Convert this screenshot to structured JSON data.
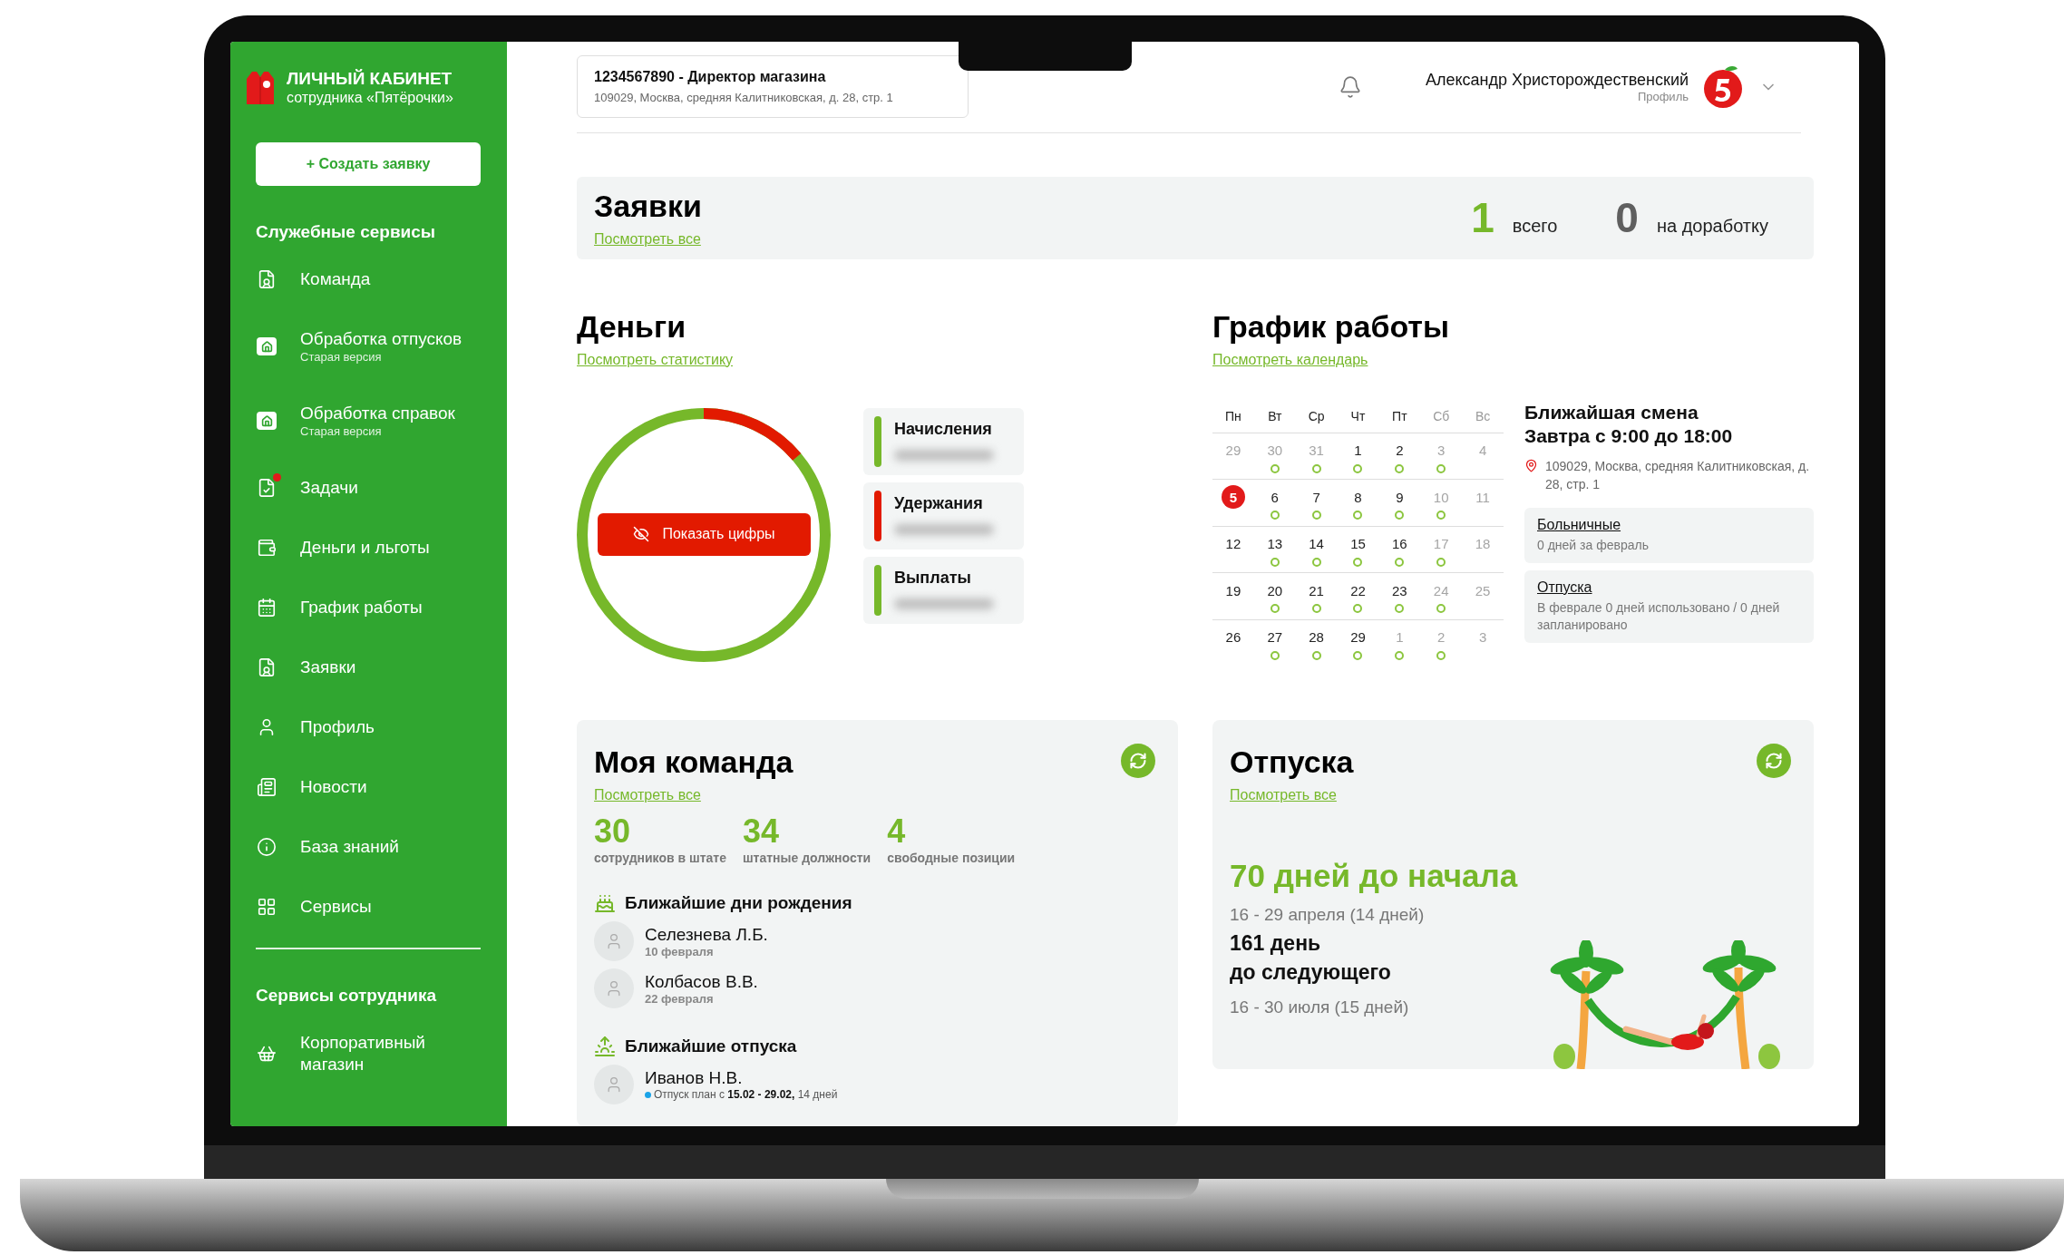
{
  "sidebar": {
    "logo_title": "ЛИЧНЫЙ КАБИНЕТ",
    "logo_subtitle": "сотрудника «Пятёрочки»",
    "create_button": "+ Создать заявку",
    "sections": [
      {
        "title": "Служебные сервисы",
        "items": [
          {
            "label": "Команда",
            "badge": false
          },
          {
            "label": "Обработка отпусков",
            "sublabel": "Старая версия",
            "badge": false
          },
          {
            "label": "Обработка справок",
            "sublabel": "Старая версия",
            "badge": false
          },
          {
            "label": "Задачи",
            "badge": true
          },
          {
            "label": "Деньги и льготы",
            "badge": false
          },
          {
            "label": "График работы",
            "badge": false
          },
          {
            "label": "Заявки",
            "badge": false
          },
          {
            "label": "Профиль",
            "badge": false
          },
          {
            "label": "Новости",
            "badge": false
          },
          {
            "label": "База знаний",
            "badge": false
          },
          {
            "label": "Сервисы",
            "badge": false
          }
        ]
      },
      {
        "title": "Сервисы сотрудника",
        "items": [
          {
            "label": "Корпоративный магазин",
            "badge": false
          }
        ]
      }
    ]
  },
  "header": {
    "store_title": "1234567890 - Директор магазина",
    "store_address": "109029, Москва, средняя Калитниковская, д. 28, стр. 1",
    "user_name": "Александр Христорождественский",
    "user_role": "Профиль"
  },
  "requests": {
    "title": "Заявки",
    "link": "Посмотреть все",
    "stats": [
      {
        "value": "1",
        "label": "всего",
        "color": "#76b82a"
      },
      {
        "value": "0",
        "label": "на доработку",
        "color": "#5f5f5f"
      }
    ]
  },
  "money": {
    "title": "Деньги",
    "link": "Посмотреть статистику",
    "show_button": "Показать цифры",
    "legend": [
      {
        "label": "Начисления",
        "color": "#76b82a"
      },
      {
        "label": "Удержания",
        "color": "#e21a00"
      },
      {
        "label": "Выплаты",
        "color": "#76b82a"
      }
    ]
  },
  "schedule": {
    "title": "График работы",
    "link": "Посмотреть календарь",
    "weekdays": [
      {
        "label": "Пн",
        "weekend": false
      },
      {
        "label": "Вт",
        "weekend": false
      },
      {
        "label": "Ср",
        "weekend": false
      },
      {
        "label": "Чт",
        "weekend": false
      },
      {
        "label": "Пт",
        "weekend": false
      },
      {
        "label": "Сб",
        "weekend": true
      },
      {
        "label": "Вс",
        "weekend": true
      }
    ],
    "weeks": [
      [
        {
          "day": "29",
          "muted": true,
          "shift": false,
          "today": false
        },
        {
          "day": "30",
          "muted": true,
          "shift": true,
          "today": false
        },
        {
          "day": "31",
          "muted": true,
          "shift": true,
          "today": false
        },
        {
          "day": "1",
          "muted": false,
          "shift": true,
          "today": false
        },
        {
          "day": "2",
          "muted": false,
          "shift": true,
          "today": false
        },
        {
          "day": "3",
          "muted": true,
          "shift": true,
          "today": false
        },
        {
          "day": "4",
          "muted": true,
          "shift": false,
          "today": false
        }
      ],
      [
        {
          "day": "5",
          "muted": false,
          "shift": false,
          "today": true
        },
        {
          "day": "6",
          "muted": false,
          "shift": true,
          "today": false
        },
        {
          "day": "7",
          "muted": false,
          "shift": true,
          "today": false
        },
        {
          "day": "8",
          "muted": false,
          "shift": true,
          "today": false
        },
        {
          "day": "9",
          "muted": false,
          "shift": true,
          "today": false
        },
        {
          "day": "10",
          "muted": true,
          "shift": true,
          "today": false
        },
        {
          "day": "11",
          "muted": true,
          "shift": false,
          "today": false
        }
      ],
      [
        {
          "day": "12",
          "muted": false,
          "shift": false,
          "today": false
        },
        {
          "day": "13",
          "muted": false,
          "shift": true,
          "today": false
        },
        {
          "day": "14",
          "muted": false,
          "shift": true,
          "today": false
        },
        {
          "day": "15",
          "muted": false,
          "shift": true,
          "today": false
        },
        {
          "day": "16",
          "muted": false,
          "shift": true,
          "today": false
        },
        {
          "day": "17",
          "muted": true,
          "shift": true,
          "today": false
        },
        {
          "day": "18",
          "muted": true,
          "shift": false,
          "today": false
        }
      ],
      [
        {
          "day": "19",
          "muted": false,
          "shift": false,
          "today": false
        },
        {
          "day": "20",
          "muted": false,
          "shift": true,
          "today": false
        },
        {
          "day": "21",
          "muted": false,
          "shift": true,
          "today": false
        },
        {
          "day": "22",
          "muted": false,
          "shift": true,
          "today": false
        },
        {
          "day": "23",
          "muted": false,
          "shift": true,
          "today": false
        },
        {
          "day": "24",
          "muted": true,
          "shift": true,
          "today": false
        },
        {
          "day": "25",
          "muted": true,
          "shift": false,
          "today": false
        }
      ],
      [
        {
          "day": "26",
          "muted": false,
          "shift": false,
          "today": false
        },
        {
          "day": "27",
          "muted": false,
          "shift": true,
          "today": false
        },
        {
          "day": "28",
          "muted": false,
          "shift": true,
          "today": false
        },
        {
          "day": "29",
          "muted": false,
          "shift": true,
          "today": false
        },
        {
          "day": "1",
          "muted": true,
          "shift": true,
          "today": false
        },
        {
          "day": "2",
          "muted": true,
          "shift": true,
          "today": false
        },
        {
          "day": "3",
          "muted": true,
          "shift": false,
          "today": false
        }
      ]
    ],
    "next_shift": {
      "title": "Ближайшая смена",
      "time": "Завтра с 9:00 до 18:00",
      "address": "109029, Москва, средняя Калитниковская, д. 28, стр. 1"
    },
    "info_cards": [
      {
        "title": "Больничные",
        "text": "0 дней за февраль"
      },
      {
        "title": "Отпуска",
        "text": "В феврале 0 дней использовано / 0 дней запланировано"
      }
    ]
  },
  "team": {
    "title": "Моя команда",
    "link": "Посмотреть все",
    "stats": [
      {
        "value": "30",
        "label": "сотрудников в штате"
      },
      {
        "value": "34",
        "label": "штатные должности"
      },
      {
        "value": "4",
        "label": "свободные позиции"
      }
    ],
    "birthdays": {
      "title": "Ближайшие дни рождения",
      "people": [
        {
          "name": "Селезнева Л.Б.",
          "date": "10 февраля"
        },
        {
          "name": "Колбасов В.В.",
          "date": "22 февраля"
        }
      ]
    },
    "vacations": {
      "title": "Ближайшие отпуска",
      "people": [
        {
          "name": "Иванов Н.В.",
          "note": "Отпуск план с **15.02 - 29.02,** 14 дней",
          "color": "#1aa3e8"
        }
      ]
    }
  },
  "vacation": {
    "title": "Отпуска",
    "link": "Посмотреть все",
    "countdown": "70 дней до начала",
    "first_range": "16 - 29 апреля (14 дней)",
    "next_count": "161 день",
    "next_label": "до следующего",
    "next_range": "16 - 30 июля (15 дней)"
  }
}
